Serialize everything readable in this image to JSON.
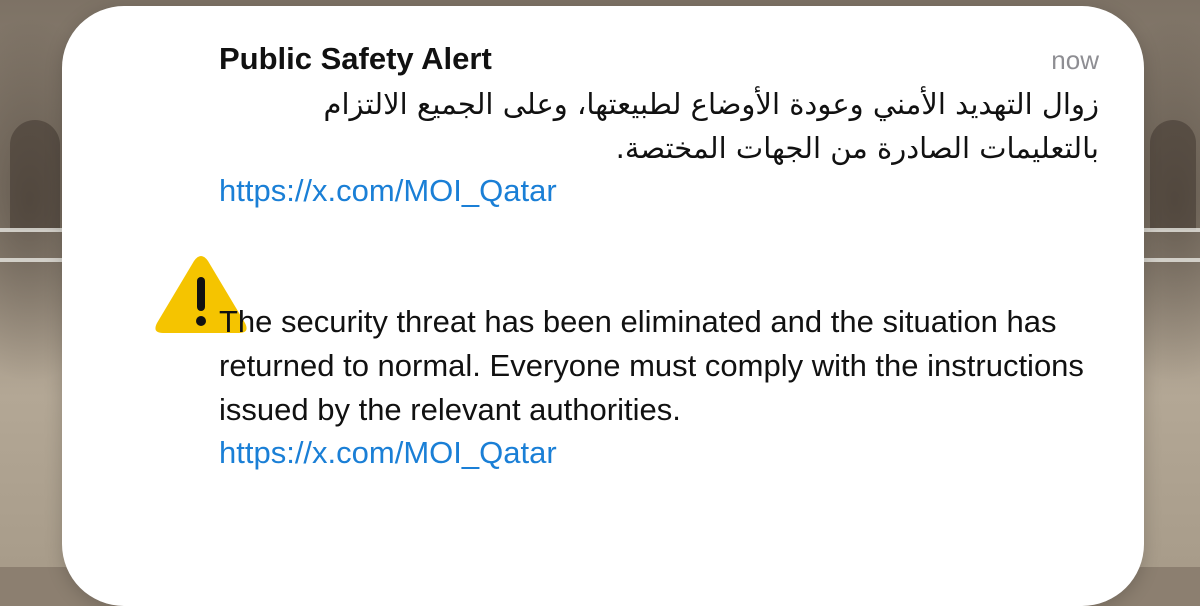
{
  "notification": {
    "title": "Public Safety Alert",
    "timestamp": "now",
    "arabic_message": "زوال التهديد الأمني وعودة الأوضاع لطبيعتها، وعلى الجميع الالتزام بالتعليمات الصادرة من الجهات المختصة.",
    "arabic_link": "https://x.com/MOI_Qatar",
    "english_message": "The security threat has been eliminated and the situation has returned to normal. Everyone must comply with the instructions issued by the relevant authorities.",
    "english_link": "https://x.com/MOI_Qatar",
    "icon": "warning-triangle-icon",
    "colors": {
      "warning": "#f5c400",
      "link": "#1a7fd6",
      "card_background": "#ffffff",
      "timestamp": "#8e8e93"
    }
  }
}
